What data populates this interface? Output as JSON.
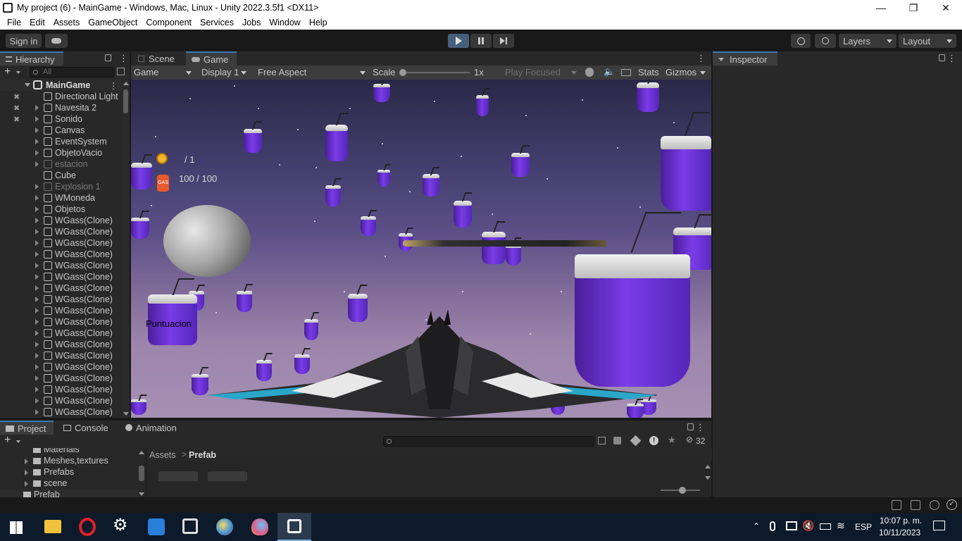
{
  "window": {
    "title": "My project (6) - MainGame - Windows, Mac, Linux - Unity 2022.3.5f1 <DX11>"
  },
  "menu": [
    "File",
    "Edit",
    "Assets",
    "GameObject",
    "Component",
    "Services",
    "Jobs",
    "Window",
    "Help"
  ],
  "toolbar": {
    "sign_in": "Sign in",
    "layers": "Layers",
    "layout": "Layout"
  },
  "hierarchy": {
    "tab": "Hierarchy",
    "search_placeholder": "All",
    "root": "MainGame",
    "items": [
      {
        "label": "Directional Light",
        "dim": false
      },
      {
        "label": "Navesita 2",
        "dim": false
      },
      {
        "label": "Sonido",
        "dim": false
      },
      {
        "label": "Canvas",
        "dim": false
      },
      {
        "label": "EventSystem",
        "dim": false
      },
      {
        "label": "ObjetoVacio",
        "dim": false
      },
      {
        "label": "estacion",
        "dim": true
      },
      {
        "label": "Cube",
        "dim": false
      },
      {
        "label": "Explosion 1",
        "dim": true
      },
      {
        "label": "WMoneda",
        "dim": false
      },
      {
        "label": "Objetos",
        "dim": false
      },
      {
        "label": "WGass(Clone)",
        "dim": false
      },
      {
        "label": "WGass(Clone)",
        "dim": false
      },
      {
        "label": "WGass(Clone)",
        "dim": false
      },
      {
        "label": "WGass(Clone)",
        "dim": false
      },
      {
        "label": "WGass(Clone)",
        "dim": false
      },
      {
        "label": "WGass(Clone)",
        "dim": false
      },
      {
        "label": "WGass(Clone)",
        "dim": false
      },
      {
        "label": "WGass(Clone)",
        "dim": false
      },
      {
        "label": "WGass(Clone)",
        "dim": false
      },
      {
        "label": "WGass(Clone)",
        "dim": false
      },
      {
        "label": "WGass(Clone)",
        "dim": false
      },
      {
        "label": "WGass(Clone)",
        "dim": false
      },
      {
        "label": "WGass(Clone)",
        "dim": false
      },
      {
        "label": "WGass(Clone)",
        "dim": false
      },
      {
        "label": "WGass(Clone)",
        "dim": false
      },
      {
        "label": "WGass(Clone)",
        "dim": false
      },
      {
        "label": "WGass(Clone)",
        "dim": false
      },
      {
        "label": "WGass(Clone)",
        "dim": false
      },
      {
        "label": "WGass(Clone)",
        "dim": false
      }
    ]
  },
  "game": {
    "tab_scene": "Scene",
    "tab_game": "Game",
    "mode": "Game",
    "display": "Display 1",
    "aspect": "Free Aspect",
    "scale_label": "Scale",
    "scale_value": "1x",
    "play_focused": "Play Focused",
    "stats": "Stats",
    "gizmos": "Gizmos",
    "hud_coins": "/ 1",
    "hud_gas_label": "GAS",
    "hud_gas": "100 / 100",
    "hud_score": "Puntuacion"
  },
  "inspector": {
    "tab": "Inspector"
  },
  "project": {
    "tabs": [
      "Project",
      "Console",
      "Animation"
    ],
    "folders": [
      "Materials",
      "Meshes,textures",
      "Prefabs",
      "scene"
    ],
    "selected_folder": "Prefab",
    "breadcrumb_root": "Assets",
    "breadcrumb_current": "Prefab",
    "hidden_count": "32"
  },
  "taskbar": {
    "lang": "ESP",
    "time": "10:07 p. m.",
    "date": "10/11/2023"
  },
  "colors": {
    "editor_bg": "#191919",
    "panel_bg": "#282828",
    "play_accent": "#46607c",
    "tab_accent": "#3a79bb",
    "can_purple": "#7a3ce8"
  }
}
